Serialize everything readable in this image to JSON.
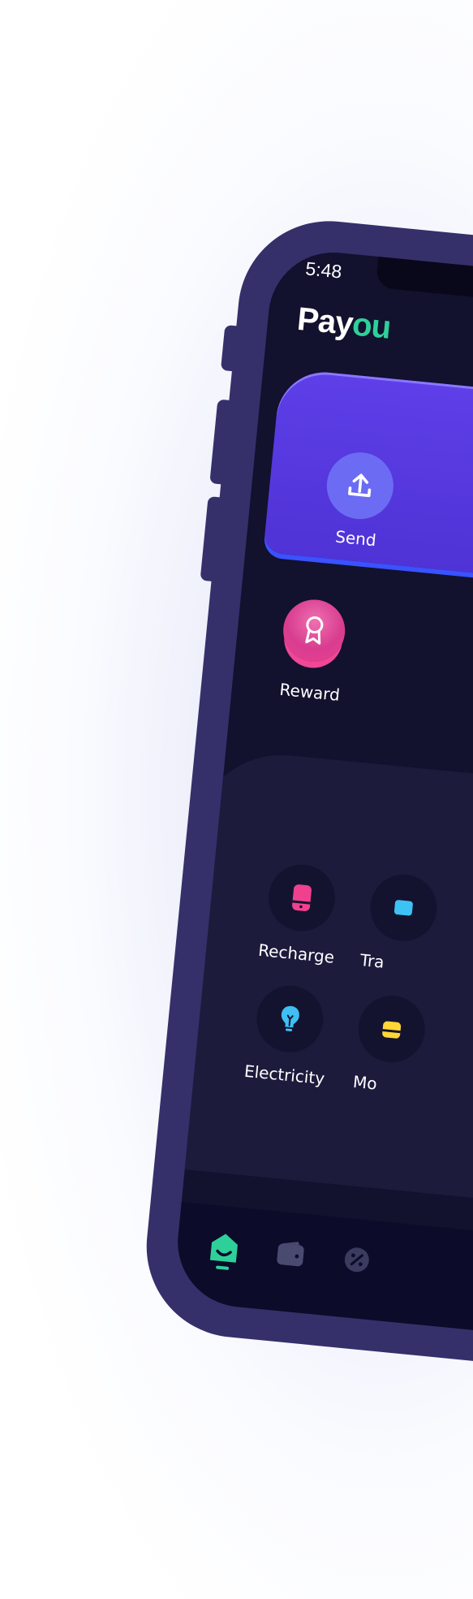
{
  "status_bar": {
    "time": "5:48"
  },
  "brand": {
    "part1": "Pay",
    "part2": "ou"
  },
  "colors": {
    "background": "#ffffff",
    "phone_frame": "#35306a",
    "screen_bg": "#12112e",
    "accent_green": "#2ed09a",
    "card_purple": "#5e3fe8",
    "reward_pink": "#ee3f92",
    "services_panel": "#1d1b3c",
    "tab_bar": "#0c0b2a"
  },
  "quick_actions": [
    {
      "label": "Send",
      "icon": "upload-arrow-icon"
    }
  ],
  "secondary_actions": [
    {
      "label": "Reward",
      "icon": "ribbon-badge-icon"
    }
  ],
  "services": [
    {
      "label": "Recharge",
      "icon": "phone-device-icon"
    },
    {
      "label": "Tra",
      "icon": "transport-icon"
    },
    {
      "label": "Electricity",
      "icon": "lightbulb-icon"
    },
    {
      "label": "Mo",
      "icon": "money-icon"
    }
  ],
  "tab_bar": [
    {
      "name": "home",
      "icon": "home-icon",
      "active": true
    },
    {
      "name": "wallet",
      "icon": "wallet-icon",
      "active": false
    },
    {
      "name": "offers",
      "icon": "discount-icon",
      "active": false
    }
  ]
}
